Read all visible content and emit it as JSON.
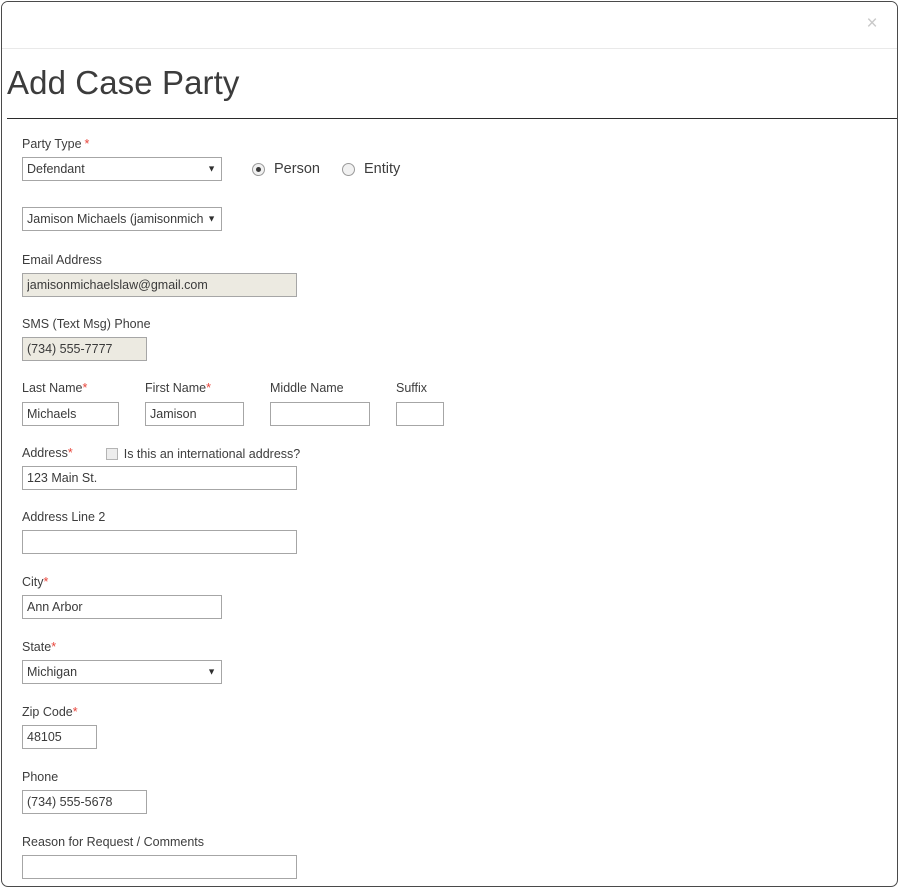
{
  "modal": {
    "close_label": "×",
    "title": "Add Case Party"
  },
  "form": {
    "party_type": {
      "label": "Party Type",
      "required_mark": "*",
      "value": "Defendant",
      "options": [
        "Defendant"
      ]
    },
    "party_kind": {
      "person_label": "Person",
      "entity_label": "Entity",
      "selected": "Person"
    },
    "person_select": {
      "value": "Jamison Michaels (jamisonmicha",
      "options": [
        "Jamison Michaels (jamisonmicha"
      ]
    },
    "email": {
      "label": "Email Address",
      "value": "jamisonmichaelslaw@gmail.com",
      "placeholder": ""
    },
    "sms_phone": {
      "label": "SMS (Text Msg) Phone",
      "value": "(734) 555-7777",
      "placeholder": ""
    },
    "last_name": {
      "label": "Last Name",
      "required_mark": "*",
      "value": "Michaels",
      "placeholder": ""
    },
    "first_name": {
      "label": "First Name",
      "required_mark": "*",
      "value": "Jamison",
      "placeholder": ""
    },
    "middle_name": {
      "label": "Middle Name",
      "value": "",
      "placeholder": ""
    },
    "suffix": {
      "label": "Suffix",
      "value": "",
      "placeholder": ""
    },
    "address": {
      "label": "Address",
      "required_mark": "*",
      "value": "123 Main St.",
      "placeholder": ""
    },
    "international": {
      "label": "Is this an international address?",
      "checked": false
    },
    "address2": {
      "label": "Address Line 2",
      "value": "",
      "placeholder": ""
    },
    "city": {
      "label": "City",
      "required_mark": "*",
      "value": "Ann Arbor",
      "placeholder": ""
    },
    "state": {
      "label": "State",
      "required_mark": "*",
      "value": "Michigan",
      "options": [
        "Michigan"
      ]
    },
    "zip": {
      "label": "Zip Code",
      "required_mark": "*",
      "value": "48105",
      "placeholder": ""
    },
    "phone": {
      "label": "Phone",
      "value": "(734) 555-5678",
      "placeholder": ""
    },
    "reason": {
      "label": "Reason for Request / Comments",
      "value": "",
      "placeholder": ""
    }
  },
  "icons": {
    "dropdown_arrow": "▼"
  },
  "colors": {
    "required_red": "#e8443a",
    "border_gray": "#a6a6a6",
    "readonly_bg": "#eceae1",
    "modal_border": "#4a4a4a"
  }
}
